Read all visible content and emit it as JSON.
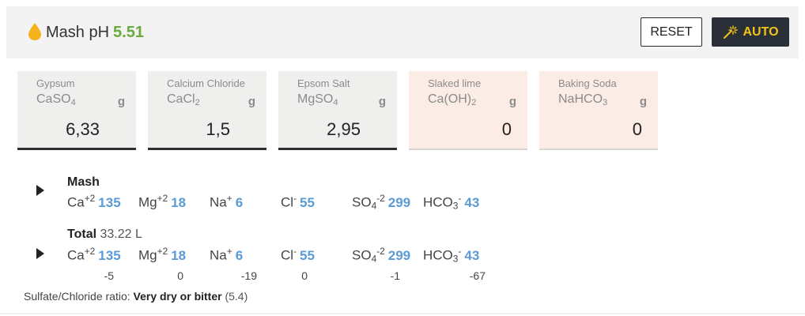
{
  "header": {
    "mash_label": "Mash pH",
    "ph_value": "5.51",
    "reset_label": "RESET",
    "auto_label": "AUTO",
    "icons": {
      "drop": "water-drop-icon",
      "wand": "magic-wand-icon"
    },
    "colors": {
      "ph": "#6aaa3a",
      "auto_bg": "#2b2f38",
      "auto_text": "#f0c419",
      "drop": "#f5b21a"
    }
  },
  "salts": [
    {
      "name": "Gypsum",
      "formula_base": "CaSO",
      "formula_sub": "4",
      "formula_tail": "",
      "unit": "g",
      "value": "6,33"
    },
    {
      "name": "Calcium Chloride",
      "formula_base": "CaCl",
      "formula_sub": "2",
      "formula_tail": "",
      "unit": "g",
      "value": "1,5"
    },
    {
      "name": "Epsom Salt",
      "formula_base": "MgSO",
      "formula_sub": "4",
      "formula_tail": "",
      "unit": "g",
      "value": "2,95"
    },
    {
      "name": "Slaked lime",
      "formula_base": "Ca(OH)",
      "formula_sub": "2",
      "formula_tail": "",
      "unit": "g",
      "value": "0"
    },
    {
      "name": "Baking Soda",
      "formula_base": "NaHCO",
      "formula_sub": "3",
      "formula_tail": "",
      "unit": "g",
      "value": "0"
    }
  ],
  "mash": {
    "title": "Mash",
    "ions": [
      {
        "base": "Ca",
        "sub": "",
        "sup": "+2",
        "value": "135"
      },
      {
        "base": "Mg",
        "sub": "",
        "sup": "+2",
        "value": "18"
      },
      {
        "base": "Na",
        "sub": "",
        "sup": "+",
        "value": "6"
      },
      {
        "base": "Cl",
        "sub": "",
        "sup": "-",
        "value": "55"
      },
      {
        "base": "SO",
        "sub": "4",
        "sup": "-2",
        "value": "299"
      },
      {
        "base": "HCO",
        "sub": "3",
        "sup": "-",
        "value": "43"
      }
    ]
  },
  "total": {
    "title": "Total",
    "volume": "33.22 L",
    "ions": [
      {
        "base": "Ca",
        "sub": "",
        "sup": "+2",
        "value": "135",
        "diff": "-5"
      },
      {
        "base": "Mg",
        "sub": "",
        "sup": "+2",
        "value": "18",
        "diff": "0"
      },
      {
        "base": "Na",
        "sub": "",
        "sup": "+",
        "value": "6",
        "diff": "-19"
      },
      {
        "base": "Cl",
        "sub": "",
        "sup": "-",
        "value": "55",
        "diff": "0"
      },
      {
        "base": "SO",
        "sub": "4",
        "sup": "-2",
        "value": "299",
        "diff": "-1"
      },
      {
        "base": "HCO",
        "sub": "3",
        "sup": "-",
        "value": "43",
        "diff": "-67"
      }
    ]
  },
  "ratio": {
    "label": "Sulfate/Chloride ratio:",
    "verdict": "Very dry or bitter",
    "value": "(5.4)"
  }
}
